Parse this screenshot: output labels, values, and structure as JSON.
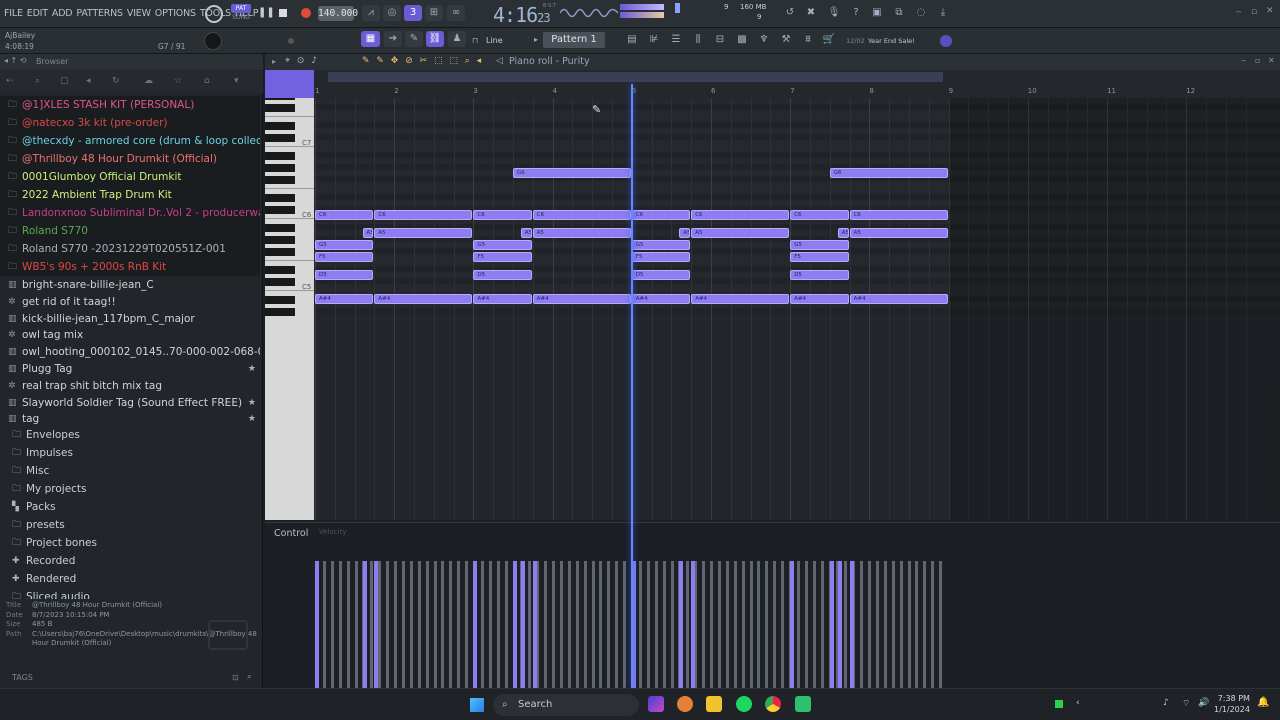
{
  "menu": [
    "FILE",
    "EDIT",
    "ADD",
    "PATTERNS",
    "VIEW",
    "OPTIONS",
    "TOOLS",
    "HELP"
  ],
  "transport": {
    "mode_top": "PAT",
    "mode_bottom": "SONG",
    "bpm": "140.000",
    "time_main": "4:16",
    "time_sub": "23",
    "time_unit": "B:S:T",
    "cpu_label": "9",
    "mem_label": "160 MB",
    "mem_num": "9"
  },
  "user": {
    "name": "AjBailey",
    "time": "4:08:19",
    "position": "G7 / 91"
  },
  "toolbar2": {
    "snap": "Line",
    "pattern": "Pattern 1",
    "promo_date": "12/02",
    "promo": "Year End Sale!"
  },
  "browser": {
    "header": "Browser",
    "items": [
      {
        "label": "@1]XLES STASH KIT (PERSONAL)",
        "color": "#e0548a",
        "icon": "folder-icon",
        "dark": true
      },
      {
        "label": "@natecxo 3k kit (pre-order)",
        "color": "#d84a4a",
        "icon": "folder-icon",
        "dark": true
      },
      {
        "label": "@thecxdy - armored core (drum & loop collection)",
        "color": "#6fd0e4",
        "icon": "folder-icon",
        "dark": true
      },
      {
        "label": "@Thrillboy 48 Hour Drumkit (Official)",
        "color": "#f07070",
        "icon": "folder-icon",
        "dark": true
      },
      {
        "label": "0001Glumboy Official Drumkit",
        "color": "#c8f07a",
        "icon": "folder-icon",
        "dark": true
      },
      {
        "label": "2022 Ambient Trap Drum Kit",
        "color": "#d6f080",
        "icon": "folder-icon",
        "dark": true
      },
      {
        "label": "Landonxnoo Subliminal Dr..Vol 2 - producerwav.com",
        "color": "#c83c8a",
        "icon": "folder-icon",
        "dark": true
      },
      {
        "label": "Roland S770",
        "color": "#5aa84a",
        "icon": "folder-icon",
        "dark": true
      },
      {
        "label": "Roland S770 -20231229T020551Z-001",
        "color": "#a8b2bc",
        "icon": "folder-icon",
        "dark": true
      },
      {
        "label": "WB5's 90s + 2000s RnB Kit",
        "color": "#e04646",
        "icon": "folder-icon",
        "dark": true
      },
      {
        "label": "bright-snare-billie-jean_C",
        "color": "#cfd6dc",
        "icon": "audio-file-icon",
        "dark": false
      },
      {
        "label": "get rid of it taag!!",
        "color": "#cfd6dc",
        "icon": "gear-icon",
        "dark": false
      },
      {
        "label": "kick-billie-jean_117bpm_C_major",
        "color": "#cfd6dc",
        "icon": "audio-file-icon",
        "dark": false
      },
      {
        "label": "owl tag mix",
        "color": "#cfd6dc",
        "icon": "gear-icon",
        "dark": false
      },
      {
        "label": "owl_hooting_000102_0145..70-000-002-068-074-37397",
        "color": "#cfd6dc",
        "icon": "audio-file-icon",
        "dark": false
      },
      {
        "label": "Plugg Tag",
        "color": "#cfd6dc",
        "icon": "audio-file-icon",
        "dark": false,
        "star": true
      },
      {
        "label": "real trap shit bitch mix tag",
        "color": "#cfd6dc",
        "icon": "gear-icon",
        "dark": false
      },
      {
        "label": "Slayworld Soldier Tag (Sound Effect FREE)",
        "color": "#cfd6dc",
        "icon": "audio-file-icon",
        "dark": false,
        "star": true
      },
      {
        "label": "tag",
        "color": "#cfd6dc",
        "icon": "audio-file-icon",
        "dark": false,
        "star": true
      }
    ],
    "folders": [
      {
        "label": "Envelopes",
        "icon": "folder-icon"
      },
      {
        "label": "Impulses",
        "icon": "folder-icon"
      },
      {
        "label": "Misc",
        "icon": "folder-icon"
      },
      {
        "label": "My projects",
        "icon": "folder-icon"
      },
      {
        "label": "Packs",
        "icon": "packs-icon"
      },
      {
        "label": "presets",
        "icon": "folder-icon"
      },
      {
        "label": "Project bones",
        "icon": "folder-icon"
      },
      {
        "label": "Recorded",
        "icon": "plus-icon"
      },
      {
        "label": "Rendered",
        "icon": "plus-icon"
      },
      {
        "label": "Sliced audio",
        "icon": "folder-icon"
      }
    ],
    "info": {
      "title_k": "Title",
      "title": "@Thrillboy 48 Hour Drumkit (Official)",
      "date_k": "Date",
      "date": "8/7/2023 10:15:04 PM",
      "size_k": "Size",
      "size": "485 B",
      "path_k": "Path",
      "path1": "C:\\Users\\baj76\\OneDrive\\Desktop\\music\\drumkits\\@Thrillboy 48",
      "path2": "Hour Drumkit (Official)"
    },
    "tags_label": "TAGS"
  },
  "piano_roll": {
    "title": "Piano roll - Purity",
    "bars": [
      "1",
      "2",
      "3",
      "4",
      "5",
      "6",
      "7",
      "8",
      "9",
      "10",
      "11",
      "12"
    ],
    "octaves": [
      "C7",
      "C6",
      "C5"
    ],
    "control_label": "Control",
    "control_target": "Velocity",
    "playhead_bar": 5.0,
    "notes": [
      {
        "pitch": "G6",
        "start": 3.5,
        "end": 5.0
      },
      {
        "pitch": "G6",
        "start": 7.5,
        "end": 9.0
      },
      {
        "pitch": "C6",
        "start": 1.0,
        "end": 1.75
      },
      {
        "pitch": "C6",
        "start": 1.75,
        "end": 3.0
      },
      {
        "pitch": "C6",
        "start": 3.0,
        "end": 3.75
      },
      {
        "pitch": "C6",
        "start": 3.75,
        "end": 5.0
      },
      {
        "pitch": "C6",
        "start": 5.0,
        "end": 5.75
      },
      {
        "pitch": "C6",
        "start": 5.75,
        "end": 7.0
      },
      {
        "pitch": "C6",
        "start": 7.0,
        "end": 7.75
      },
      {
        "pitch": "C6",
        "start": 7.75,
        "end": 9.0
      },
      {
        "pitch": "A5",
        "start": 1.6,
        "end": 1.75
      },
      {
        "pitch": "A5",
        "start": 1.75,
        "end": 3.0
      },
      {
        "pitch": "A5",
        "start": 3.6,
        "end": 3.75
      },
      {
        "pitch": "A5",
        "start": 3.75,
        "end": 5.0
      },
      {
        "pitch": "A5",
        "start": 5.6,
        "end": 5.75
      },
      {
        "pitch": "A5",
        "start": 5.75,
        "end": 7.0
      },
      {
        "pitch": "A5",
        "start": 7.6,
        "end": 7.75
      },
      {
        "pitch": "A5",
        "start": 7.75,
        "end": 9.0
      },
      {
        "pitch": "G5",
        "start": 1.0,
        "end": 1.75
      },
      {
        "pitch": "G5",
        "start": 3.0,
        "end": 3.75
      },
      {
        "pitch": "G5",
        "start": 5.0,
        "end": 5.75
      },
      {
        "pitch": "G5",
        "start": 7.0,
        "end": 7.75
      },
      {
        "pitch": "F5",
        "start": 1.0,
        "end": 1.75
      },
      {
        "pitch": "F5",
        "start": 3.0,
        "end": 3.75
      },
      {
        "pitch": "F5",
        "start": 5.0,
        "end": 5.75
      },
      {
        "pitch": "F5",
        "start": 7.0,
        "end": 7.75
      },
      {
        "pitch": "D5",
        "start": 1.0,
        "end": 1.75
      },
      {
        "pitch": "D5",
        "start": 3.0,
        "end": 3.75
      },
      {
        "pitch": "D5",
        "start": 5.0,
        "end": 5.75
      },
      {
        "pitch": "D5",
        "start": 7.0,
        "end": 7.75
      },
      {
        "pitch": "A#4",
        "start": 1.0,
        "end": 1.75
      },
      {
        "pitch": "A#4",
        "start": 1.75,
        "end": 3.0
      },
      {
        "pitch": "A#4",
        "start": 3.0,
        "end": 3.75
      },
      {
        "pitch": "A#4",
        "start": 3.75,
        "end": 5.0
      },
      {
        "pitch": "A#4",
        "start": 5.0,
        "end": 5.75
      },
      {
        "pitch": "A#4",
        "start": 5.75,
        "end": 7.0
      },
      {
        "pitch": "A#4",
        "start": 7.0,
        "end": 7.75
      },
      {
        "pitch": "A#4",
        "start": 7.75,
        "end": 9.0
      }
    ],
    "note_color": "#8e7cf0",
    "playhead_color": "#5d8cff"
  },
  "taskbar": {
    "search": "Search",
    "time": "7:38 PM",
    "date": "1/1/2024"
  }
}
